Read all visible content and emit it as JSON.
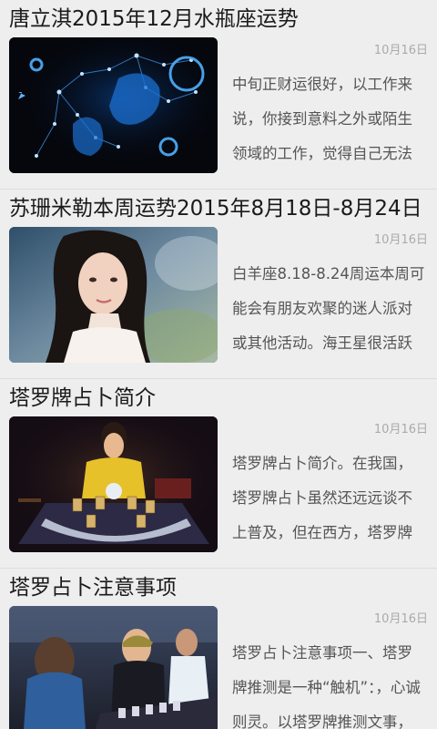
{
  "articles": [
    {
      "title": "唐立淇2015年12月水瓶座运势",
      "date": "10月16日",
      "summary": "中旬正财运很好，以工作来说，你接到意料之外或陌生领域的工作，觉得自己无法"
    },
    {
      "title": "苏珊米勒本周运势2015年8月18日-8月24日",
      "date": "10月16日",
      "summary": "白羊座8.18-8.24周运本周可能会有朋友欢聚的迷人派对或其他活动。海王星很活跃"
    },
    {
      "title": "塔罗牌占卜简介",
      "date": "10月16日",
      "summary": "塔罗牌占卜简介。在我国，塔罗牌占卜虽然还远远谈不上普及，但在西方，塔罗牌"
    },
    {
      "title": "塔罗占卜注意事项",
      "date": "10月16日",
      "summary": "塔罗占卜注意事项一、塔罗牌推测是一种“触机”：，心诚则灵。以塔罗牌推测文事，"
    }
  ]
}
